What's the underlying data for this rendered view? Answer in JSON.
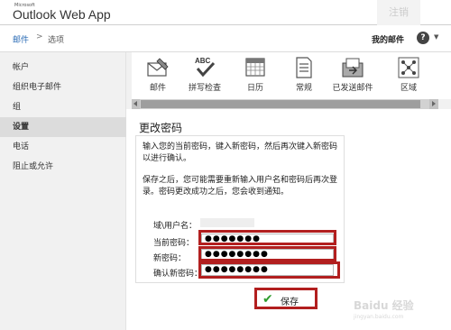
{
  "app": {
    "brand_small": "Microsoft",
    "brand": "Outlook Web App",
    "logout": "注销"
  },
  "breadcrumb": {
    "mail": "邮件",
    "sep": ">",
    "options": "选项"
  },
  "header": {
    "my_mail": "我的邮件",
    "help": "?",
    "help_caret": "▼"
  },
  "sidebar": {
    "items": [
      {
        "label": "帐户"
      },
      {
        "label": "组织电子邮件"
      },
      {
        "label": "组"
      },
      {
        "label": "设置",
        "active": true
      },
      {
        "label": "电话"
      },
      {
        "label": "阻止或允许"
      }
    ]
  },
  "toolbar": {
    "items": [
      {
        "label": "邮件",
        "icon": "mail-settings-icon"
      },
      {
        "label": "拼写检查",
        "icon": "spelling-check-icon",
        "icon_text": "ABC"
      },
      {
        "label": "日历",
        "icon": "calendar-icon"
      },
      {
        "label": "常规",
        "icon": "general-icon"
      },
      {
        "label": "已发送邮件",
        "icon": "sent-items-icon"
      },
      {
        "label": "区域",
        "icon": "region-icon"
      }
    ]
  },
  "change_password": {
    "title": "更改密码",
    "intro": "输入您的当前密码，键入新密码，然后再次键入新密码以进行确认。",
    "note": "保存之后，您可能需要重新输入用户名和密码后再次登录。密码更改成功之后，您会收到通知。",
    "labels": {
      "user": "域\\用户名：",
      "current": "当前密码：",
      "new": "新密码：",
      "confirm": "确认新密码："
    },
    "values": {
      "current": "●●●●●●●",
      "new": "●●●●●●●●",
      "confirm": "●●●●●●●●"
    },
    "save": "保存"
  },
  "colors": {
    "highlight": "#b21f1f",
    "link": "#2a6bb5",
    "check": "#2e9c2e"
  },
  "watermark": {
    "main": "Baidu 经验",
    "sub": "jingyan.baidu.com"
  }
}
